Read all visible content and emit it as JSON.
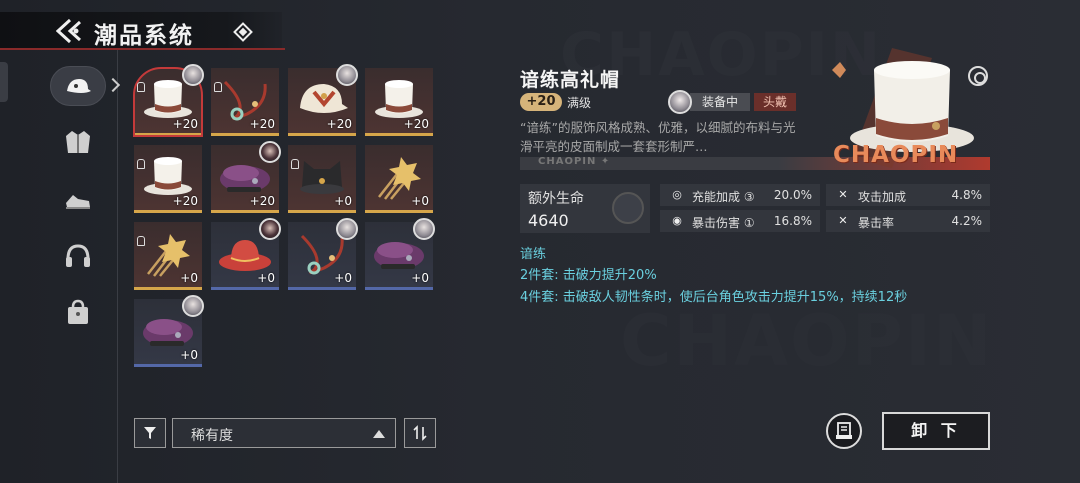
{
  "header": {
    "title": "潮品系统"
  },
  "sidebar": {
    "categories": [
      {
        "icon": "cap-icon",
        "active": true
      },
      {
        "icon": "jacket-icon",
        "active": false
      },
      {
        "icon": "shoes-icon",
        "active": false
      },
      {
        "icon": "headphones-icon",
        "active": false
      },
      {
        "icon": "bag-icon",
        "active": false
      }
    ]
  },
  "items": [
    {
      "type": "top-hat",
      "level": "+20",
      "locked": true,
      "equipped_by": "white-hair",
      "selected": true,
      "rarity": "gold"
    },
    {
      "type": "bead-cord",
      "level": "+20",
      "locked": true,
      "equipped_by": null,
      "rarity": "gold"
    },
    {
      "type": "cap",
      "level": "+20",
      "locked": false,
      "equipped_by": "white-hair",
      "rarity": "gold"
    },
    {
      "type": "top-hat",
      "level": "+20",
      "locked": false,
      "equipped_by": null,
      "rarity": "gold"
    },
    {
      "type": "top-hat",
      "level": "+20",
      "locked": true,
      "equipped_by": null,
      "rarity": "gold"
    },
    {
      "type": "beret",
      "level": "+20",
      "locked": false,
      "equipped_by": "dark-hair",
      "rarity": "gold"
    },
    {
      "type": "cat-ear-hat",
      "level": "+0",
      "locked": true,
      "equipped_by": null,
      "rarity": "gold"
    },
    {
      "type": "hairpin",
      "level": "+0",
      "locked": false,
      "equipped_by": null,
      "rarity": "gold"
    },
    {
      "type": "hairpin",
      "level": "+0",
      "locked": true,
      "equipped_by": null,
      "rarity": "gold"
    },
    {
      "type": "bucket-hat",
      "level": "+0",
      "locked": false,
      "equipped_by": "dark-hair",
      "rarity": "purple"
    },
    {
      "type": "bead-cord",
      "level": "+0",
      "locked": false,
      "equipped_by": "white-hair",
      "rarity": "purple"
    },
    {
      "type": "beret",
      "level": "+0",
      "locked": false,
      "equipped_by": "white-hair",
      "rarity": "purple"
    },
    {
      "type": "beret",
      "level": "+0",
      "locked": false,
      "equipped_by": "white-hair",
      "rarity": "purple"
    }
  ],
  "filter": {
    "sort_label": "稀有度"
  },
  "detail": {
    "name": "谙练高礼帽",
    "level": "+20",
    "max_label": "满级",
    "equipped_label": "装备中",
    "slot_label": "头戴",
    "description": "“谙练”的服饰风格成熟、优雅，以细腻的布料与光滑平亮的皮面制成一套套形制严…",
    "brand_bar": "CHAOPIN ✦",
    "brand_big": "CHAOPIN",
    "main_stat": {
      "name": "额外生命",
      "value": "4640"
    },
    "sub_stats": [
      {
        "icon": "energy-icon",
        "name": "充能加成 ③",
        "value": "20.0%"
      },
      {
        "icon": "attack-icon",
        "name": "攻击加成",
        "value": "4.8%"
      },
      {
        "icon": "crit-dmg-icon",
        "name": "暴击伤害 ①",
        "value": "16.8%"
      },
      {
        "icon": "crit-rate-icon",
        "name": "暴击率",
        "value": "4.2%"
      }
    ],
    "set": {
      "name": "谙练",
      "two_piece": "2件套: 击破力提升20%",
      "four_piece": "4件套: 击破敌人韧性条时，使后台角色攻击力提升15%，持续12秒"
    }
  },
  "actions": {
    "unequip_label": "卸 下"
  },
  "colors": {
    "accent_red": "#b03a2e",
    "set_text": "#6ad0df",
    "level_gold": "#d6b47a",
    "brand_orange": "#e88a5a"
  }
}
